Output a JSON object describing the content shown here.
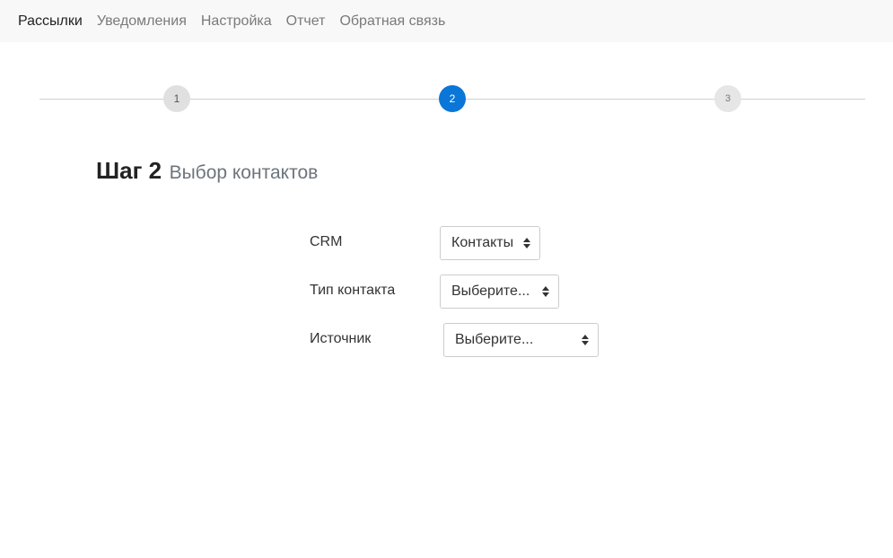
{
  "nav": {
    "items": [
      {
        "label": "Рассылки",
        "active": true
      },
      {
        "label": "Уведомления",
        "active": false
      },
      {
        "label": "Настройка",
        "active": false
      },
      {
        "label": "Отчет",
        "active": false
      },
      {
        "label": "Обратная связь",
        "active": false
      }
    ]
  },
  "stepper": {
    "steps": [
      "1",
      "2",
      "3"
    ],
    "current": 2,
    "active_color": "#0a76d8"
  },
  "heading": {
    "main": "Шаг 2",
    "sub": "Выбор контактов"
  },
  "form": {
    "crm": {
      "label": "CRM",
      "value": "Контакты"
    },
    "contact_type": {
      "label": "Тип контакта",
      "value": "Выберите..."
    },
    "source": {
      "label": "Источник",
      "value": "Выберите..."
    }
  },
  "icons": {
    "select_caret": "updown-caret-icon"
  }
}
